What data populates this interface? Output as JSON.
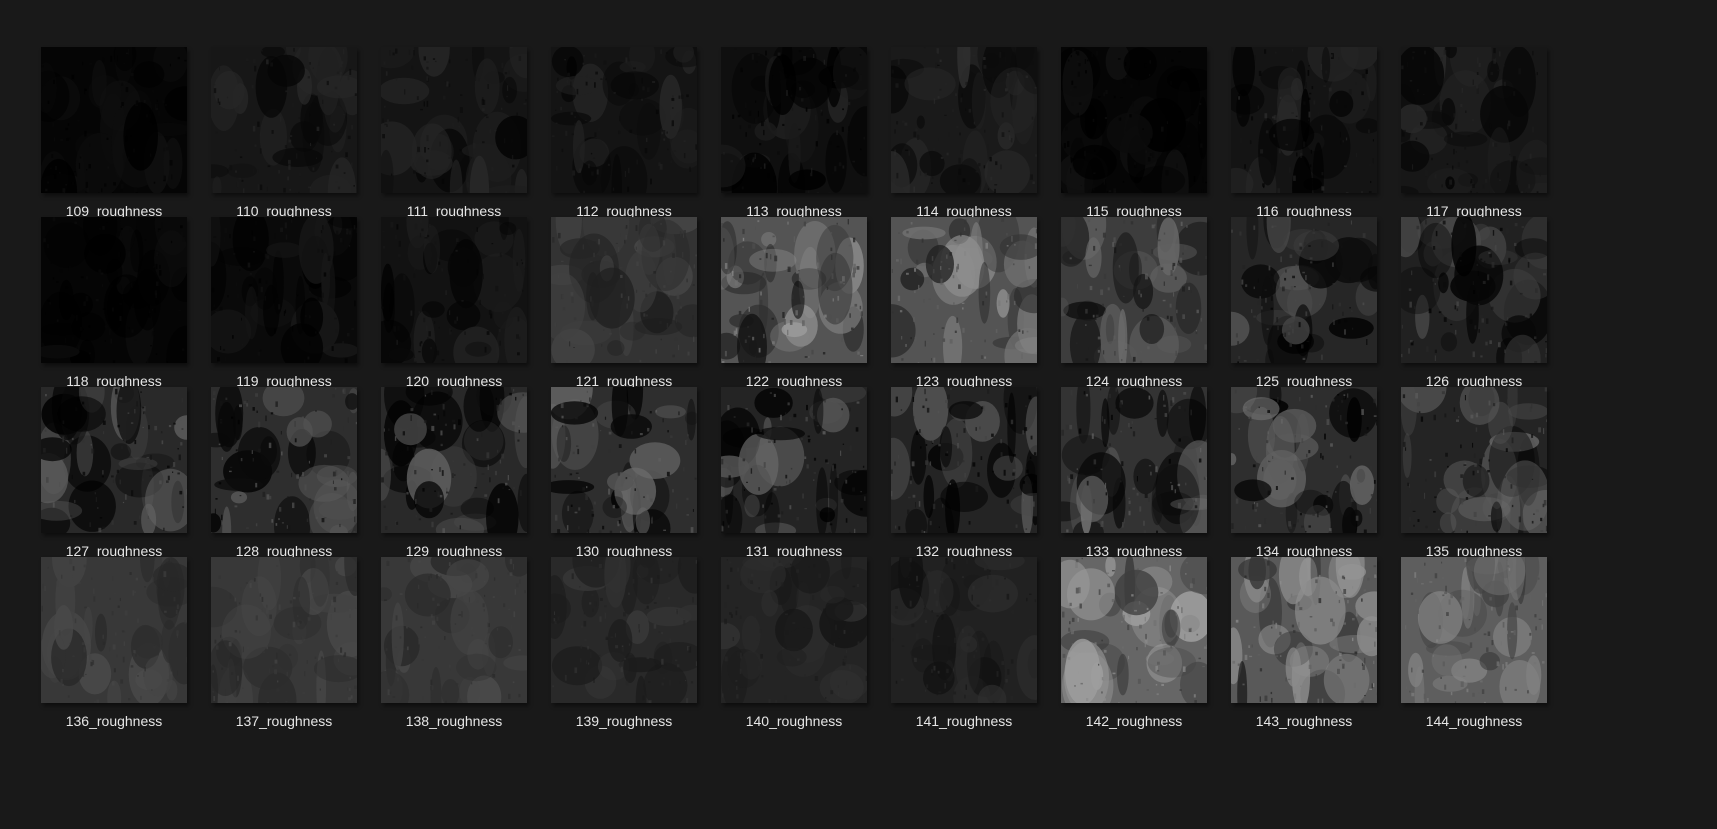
{
  "window": {
    "background": "#191919",
    "view": "large-icons-grid",
    "label_color": "#e6e6e6"
  },
  "files": [
    {
      "name": "109_roughness",
      "tone": 0.02,
      "contrast": 0.05
    },
    {
      "name": "110_roughness",
      "tone": 0.09,
      "contrast": 0.08
    },
    {
      "name": "111_roughness",
      "tone": 0.08,
      "contrast": 0.08
    },
    {
      "name": "112_roughness",
      "tone": 0.08,
      "contrast": 0.08
    },
    {
      "name": "113_roughness",
      "tone": 0.06,
      "contrast": 0.1
    },
    {
      "name": "114_roughness",
      "tone": 0.1,
      "contrast": 0.1
    },
    {
      "name": "115_roughness",
      "tone": 0.02,
      "contrast": 0.05
    },
    {
      "name": "116_roughness",
      "tone": 0.08,
      "contrast": 0.12
    },
    {
      "name": "117_roughness",
      "tone": 0.09,
      "contrast": 0.08
    },
    {
      "name": "118_roughness",
      "tone": 0.02,
      "contrast": 0.04
    },
    {
      "name": "119_roughness",
      "tone": 0.04,
      "contrast": 0.06
    },
    {
      "name": "120_roughness",
      "tone": 0.07,
      "contrast": 0.07
    },
    {
      "name": "121_roughness",
      "tone": 0.2,
      "contrast": 0.1
    },
    {
      "name": "122_roughness",
      "tone": 0.33,
      "contrast": 0.3
    },
    {
      "name": "123_roughness",
      "tone": 0.33,
      "contrast": 0.25
    },
    {
      "name": "124_roughness",
      "tone": 0.24,
      "contrast": 0.22
    },
    {
      "name": "125_roughness",
      "tone": 0.15,
      "contrast": 0.2
    },
    {
      "name": "126_roughness",
      "tone": 0.13,
      "contrast": 0.2
    },
    {
      "name": "127_roughness",
      "tone": 0.16,
      "contrast": 0.25
    },
    {
      "name": "128_roughness",
      "tone": 0.18,
      "contrast": 0.25
    },
    {
      "name": "129_roughness",
      "tone": 0.16,
      "contrast": 0.25
    },
    {
      "name": "130_roughness",
      "tone": 0.18,
      "contrast": 0.25
    },
    {
      "name": "131_roughness",
      "tone": 0.14,
      "contrast": 0.28
    },
    {
      "name": "132_roughness",
      "tone": 0.14,
      "contrast": 0.28
    },
    {
      "name": "133_roughness",
      "tone": 0.2,
      "contrast": 0.28
    },
    {
      "name": "134_roughness",
      "tone": 0.18,
      "contrast": 0.28
    },
    {
      "name": "135_roughness",
      "tone": 0.14,
      "contrast": 0.28
    },
    {
      "name": "136_roughness",
      "tone": 0.22,
      "contrast": 0.08
    },
    {
      "name": "137_roughness",
      "tone": 0.22,
      "contrast": 0.08
    },
    {
      "name": "138_roughness",
      "tone": 0.22,
      "contrast": 0.08
    },
    {
      "name": "139_roughness",
      "tone": 0.16,
      "contrast": 0.08
    },
    {
      "name": "140_roughness",
      "tone": 0.14,
      "contrast": 0.06
    },
    {
      "name": "141_roughness",
      "tone": 0.13,
      "contrast": 0.07
    },
    {
      "name": "142_roughness",
      "tone": 0.4,
      "contrast": 0.25
    },
    {
      "name": "143_roughness",
      "tone": 0.35,
      "contrast": 0.28
    },
    {
      "name": "144_roughness",
      "tone": 0.37,
      "contrast": 0.2
    }
  ]
}
